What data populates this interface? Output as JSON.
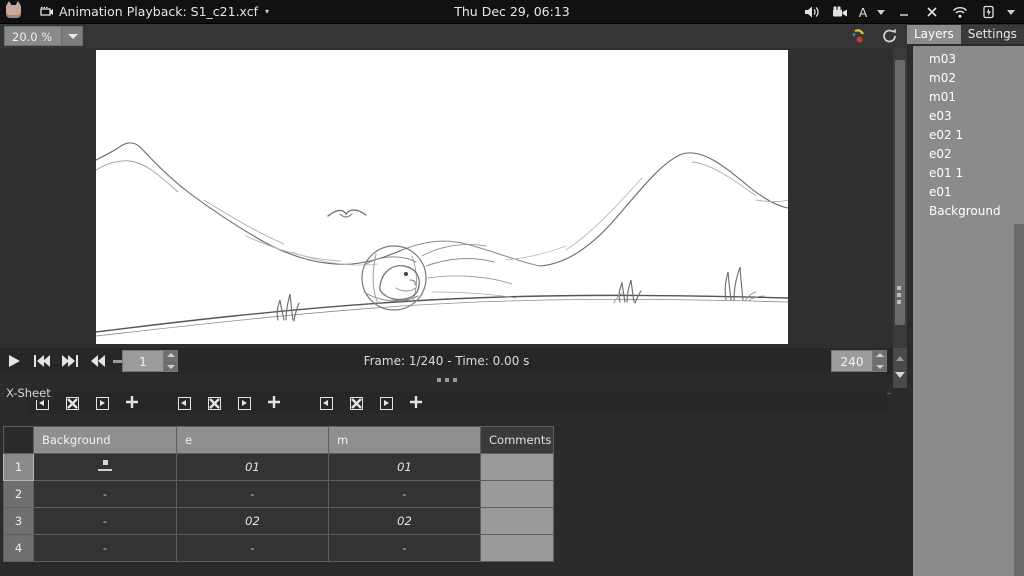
{
  "system_bar": {
    "app_icon": "cat-app-icon",
    "window_icon": "film-strip-icon",
    "title": "Animation Playback: S1_c21.xcf",
    "title_dropdown": "▾",
    "clock": "Thu Dec 29, 06:13",
    "tray": [
      {
        "name": "volume-icon",
        "label": "🔊"
      },
      {
        "name": "screen-recorder-icon",
        "label": "🎥"
      },
      {
        "name": "keyboard-layout-indicator",
        "label": "A"
      },
      {
        "name": "minimize-button",
        "label": "_"
      },
      {
        "name": "close-button",
        "label": "✕"
      },
      {
        "name": "wifi-icon",
        "label": "wifi"
      },
      {
        "name": "battery-icon",
        "label": "battery"
      },
      {
        "name": "tray-dropdown-icon",
        "label": "▾"
      }
    ]
  },
  "viewer_toolbar": {
    "zoom_value": "20.0 %",
    "zoom_dropdown": "chevron-down-icon",
    "detach_icon": "onion-skin-icon",
    "refresh_icon": "refresh-icon"
  },
  "canvas": {
    "artwork_description": "pencil sketch landscape with mountains, a flying bird, a character rolling in a ball, and grass tufts"
  },
  "playback": {
    "buttons": [
      {
        "name": "play-button",
        "label": "play"
      },
      {
        "name": "skip-to-start-button",
        "label": "skip-start"
      },
      {
        "name": "skip-to-end-button",
        "label": "skip-end"
      },
      {
        "name": "rewind-button",
        "label": "rewind"
      }
    ],
    "start_frame": "1",
    "end_frame": "240",
    "status": "Frame: 1/240 - Time: 0.00 s"
  },
  "xsheet": {
    "legend": "X-Sheet",
    "toolbar_groups": [
      [
        {
          "name": "step-left-button",
          "icon": "arrow-left-box-icon"
        },
        {
          "name": "delete-cell-button",
          "icon": "x-box-icon"
        },
        {
          "name": "step-right-button",
          "icon": "arrow-right-box-icon"
        },
        {
          "name": "add-cell-button",
          "icon": "plus-icon"
        }
      ],
      [
        {
          "name": "step-left-button",
          "icon": "arrow-left-box-icon"
        },
        {
          "name": "delete-cell-button",
          "icon": "x-box-icon"
        },
        {
          "name": "step-right-button",
          "icon": "arrow-right-box-icon"
        },
        {
          "name": "add-cell-button",
          "icon": "plus-icon"
        }
      ],
      [
        {
          "name": "step-left-button",
          "icon": "arrow-left-box-icon"
        },
        {
          "name": "delete-cell-button",
          "icon": "x-box-icon"
        },
        {
          "name": "step-right-button",
          "icon": "arrow-right-box-icon"
        },
        {
          "name": "add-cell-button",
          "icon": "plus-icon"
        }
      ]
    ],
    "columns": [
      "Background",
      "e",
      "m",
      "Comments"
    ],
    "rows": [
      {
        "num": "1",
        "background": "*",
        "e": "01",
        "m": "01",
        "comments": "",
        "selected": true
      },
      {
        "num": "2",
        "background": "-",
        "e": "-",
        "m": "-",
        "comments": "",
        "selected": false
      },
      {
        "num": "3",
        "background": "-",
        "e": "02",
        "m": "02",
        "comments": "",
        "selected": false
      },
      {
        "num": "4",
        "background": "-",
        "e": "-",
        "m": "-",
        "comments": "",
        "selected": false
      }
    ]
  },
  "dock": {
    "tabs": [
      {
        "name": "tab-layers",
        "label": "Layers",
        "active": true
      },
      {
        "name": "tab-settings",
        "label": "Settings",
        "active": false
      }
    ],
    "layers": [
      {
        "label": "m03"
      },
      {
        "label": "m02"
      },
      {
        "label": "m01"
      },
      {
        "label": "e03"
      },
      {
        "label": "e02 1"
      },
      {
        "label": "e02"
      },
      {
        "label": "e01 1"
      },
      {
        "label": "e01"
      },
      {
        "label": "Background"
      }
    ]
  },
  "colors": {
    "system_bar_bg": "#111111",
    "panel_bg": "#2b2b2b",
    "toolbar_bg": "#353535",
    "dock_bg": "#8b8b8b",
    "cell_bg": "#333333",
    "header_bg": "#8f8f8f"
  }
}
